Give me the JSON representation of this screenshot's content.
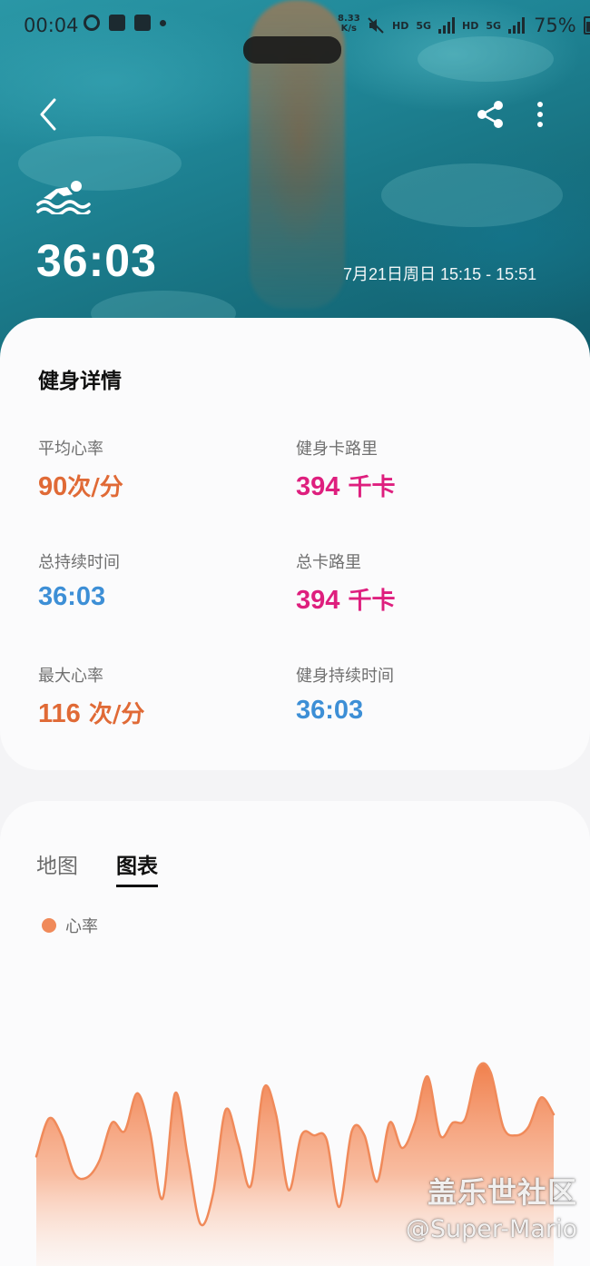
{
  "status_bar": {
    "time": "00:04",
    "net_speed_value": "8.33",
    "net_speed_unit": "K/s",
    "hd1": "HD",
    "network": "5G",
    "hd2": "HD",
    "network2": "5G",
    "battery": "75%"
  },
  "header": {
    "duration": "36:03",
    "date_range": "7月21日周日 15:15 - 15:51",
    "activity_icon": "swimming-icon"
  },
  "details": {
    "title": "健身详情",
    "metrics": [
      {
        "label": "平均心率",
        "number": "90",
        "unit": "次/分",
        "color": "#e06a36"
      },
      {
        "label": "健身卡路里",
        "number": "394",
        "unit": " 千卡",
        "color": "#de1f7e"
      },
      {
        "label": "总持续时间",
        "number": "36:03",
        "unit": "",
        "color": "#3d8fd6"
      },
      {
        "label": "总卡路里",
        "number": "394",
        "unit": " 千卡",
        "color": "#de1f7e"
      },
      {
        "label": "最大心率",
        "number": "116",
        "unit": " 次/分",
        "color": "#e06a36"
      },
      {
        "label": "健身持续时间",
        "number": "36:03",
        "unit": "",
        "color": "#3d8fd6"
      }
    ]
  },
  "chart_section": {
    "tabs": [
      {
        "label": "地图",
        "active": false
      },
      {
        "label": "图表",
        "active": true
      }
    ],
    "legend_label": "心率",
    "legend_color": "#f08a5a"
  },
  "chart_data": {
    "type": "area",
    "title": "",
    "series": [
      {
        "name": "心率",
        "color": "#f08a5a",
        "values": [
          96,
          105,
          101,
          92,
          91,
          95,
          104,
          102,
          111,
          102,
          86,
          111,
          96,
          80,
          87,
          107,
          99,
          89,
          112,
          106,
          88,
          101,
          101,
          100,
          84,
          102,
          101,
          90,
          104,
          98,
          104,
          115,
          101,
          104,
          105,
          117,
          116,
          103,
          101,
          103,
          110,
          106
        ]
      }
    ]
  },
  "watermark": {
    "line1": "盖乐世社区",
    "line2": "@Super-Mario"
  }
}
